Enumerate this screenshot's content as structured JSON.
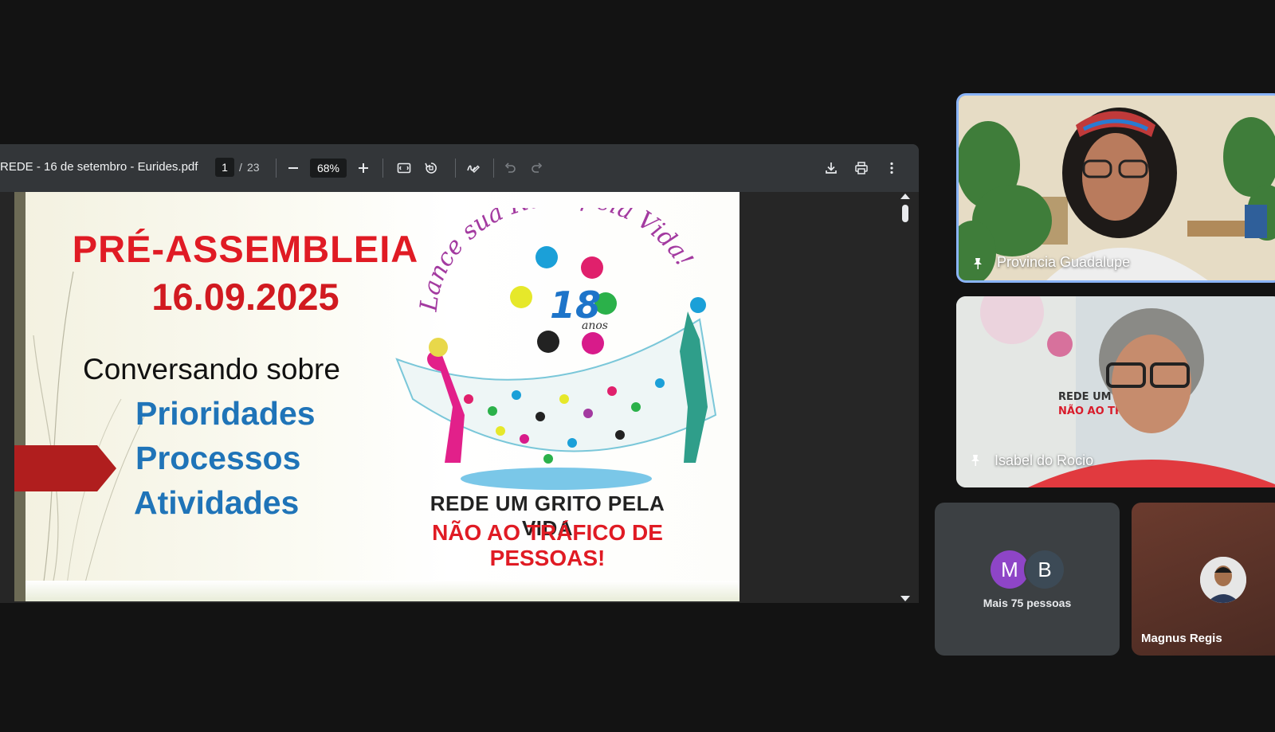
{
  "viewer": {
    "doc_title": "REDE - 16 de setembro - Eurides.pdf",
    "page_current": "1",
    "page_sep": "/",
    "page_total": "23",
    "zoom": "68%",
    "icons": [
      "zoom-out-icon",
      "zoom-in-icon",
      "fit-page-icon",
      "rotate-icon",
      "annotate-icon",
      "undo-icon",
      "redo-icon",
      "download-icon",
      "print-icon",
      "more-icon"
    ]
  },
  "slide": {
    "title": "PRÉ-ASSEMBLEIA",
    "date": "16.09.2025",
    "conversando": "Conversando sobre",
    "items": [
      "Prioridades",
      "Processos",
      "Atividades"
    ],
    "logo_arc": "Lance sua Rede pela Vida!",
    "logo_years": "18",
    "logo_years_unit": "anos",
    "rede_line1": "REDE UM GRITO PELA VIDA",
    "rede_line2": "NÃO AO TRÁFICO DE PESSOAS!"
  },
  "participants": {
    "tile1": {
      "name": "Provincia Guadalupe"
    },
    "tile2": {
      "name": "Isabel do Rocio",
      "bg_text1": "REDE UM GR",
      "bg_text2": "NÃO AO TRÁ"
    },
    "tile3": {
      "avatar1": "M",
      "avatar2": "B",
      "label": "Mais 75 pessoas"
    },
    "tile4": {
      "name": "Magnus Regis"
    }
  },
  "colors": {
    "accent_border": "#8ab4f8",
    "title_red": "#e01b24",
    "item_blue": "#1f74b8",
    "avatar_m": "#8e45c7",
    "avatar_b": "#3c4a56"
  }
}
